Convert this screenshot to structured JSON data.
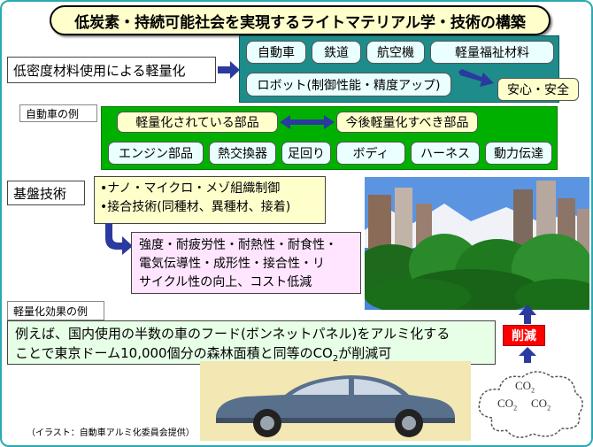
{
  "title": "低炭素・持続可能社会を実現するライトマテリアル学・技術の構築",
  "lightweighting": {
    "label": "低密度材料使用による軽量化",
    "applications": [
      "自動車",
      "鉄道",
      "航空機",
      "軽量福祉材料",
      "ロボット(制御性能・精度アップ)"
    ],
    "outcome": "安心・安全"
  },
  "auto_example": {
    "tag": "自動車の例",
    "current": "軽量化されている部品",
    "future": "今後軽量化すべき部品",
    "parts": [
      "エンジン部品",
      "熱交換器",
      "足回り",
      "ボディ",
      "ハーネス",
      "動力伝達"
    ]
  },
  "base_tech": {
    "label": "基盤技術",
    "items": [
      "•ナノ・マイクロ・メゾ組織制御",
      "•接合技術(同種材、異種材、接着)"
    ],
    "result_lines": [
      "強度・耐疲労性・耐熱性・耐食性・",
      "電気伝導性・成形性・接合性・リ",
      "サイクル性の向上、コスト低減"
    ]
  },
  "effect": {
    "tag": "軽量化効果の例",
    "line1": "例えば、国内使用の半数の車のフード(ボンネットパネル)をアルミ化する",
    "line2_prefix": "ことで東京ドーム10,000個分の森林面積と同等のCO",
    "line2_sub": "2",
    "line2_suffix": "が削減可"
  },
  "reduction_label": "削減",
  "co2_cloud": {
    "text": "CO",
    "sub": "2"
  },
  "credit": "（イラスト：自動車アルミ化委員会提供）",
  "colors": {
    "teal": "#1e8c8a",
    "green": "#00b000",
    "arrow_blue": "#2b3a9e",
    "red": "#ff0000",
    "border_teal": "#2aa9b3"
  }
}
